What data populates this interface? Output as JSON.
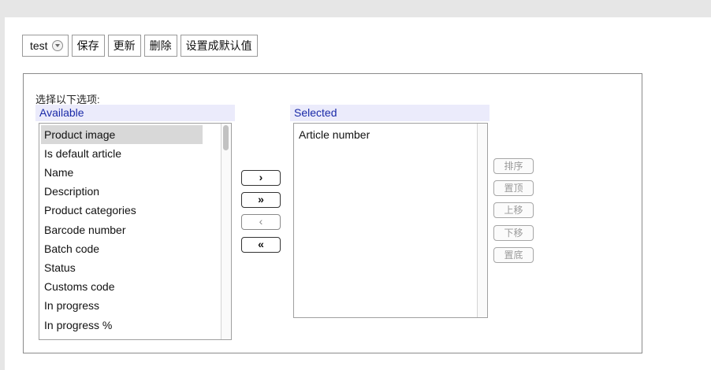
{
  "toolbar": {
    "preset_select": {
      "value": "test"
    },
    "save_label": "保存",
    "update_label": "更新",
    "delete_label": "删除",
    "set_default_label": "设置成默认值"
  },
  "panel": {
    "prompt": "选择以下选项:",
    "available": {
      "header": "Available",
      "items": [
        "Product image",
        "Is default article",
        "Name",
        "Description",
        "Product categories",
        "Barcode number",
        "Batch code",
        "Status",
        "Customs code",
        "In progress",
        "In progress %"
      ],
      "highlighted": "Product image"
    },
    "selected": {
      "header": "Selected",
      "items": [
        "Article number"
      ]
    },
    "move_buttons": {
      "add": "›",
      "add_all": "»",
      "remove": "‹",
      "remove_all": "«"
    },
    "order_buttons": {
      "sort": "排序",
      "top": "置顶",
      "up": "上移",
      "down": "下移",
      "bottom": "置底"
    }
  }
}
